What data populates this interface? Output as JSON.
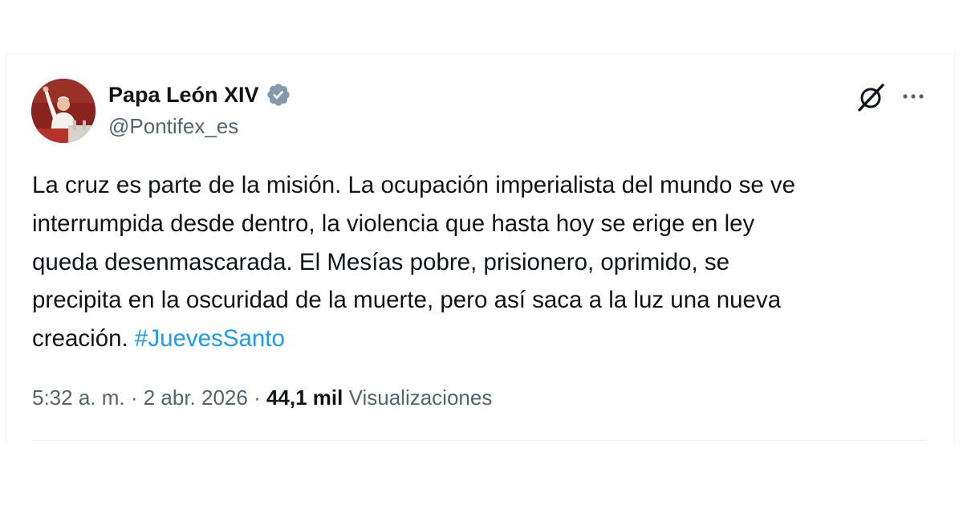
{
  "author": {
    "name": "Papa León XIV",
    "handle": "@Pontifex_es",
    "verified_color": "#829aab"
  },
  "tweet": {
    "text_lines": [
      "La cruz es parte de la misión. La ocupación imperialista del mundo se ve",
      "interrumpida desde dentro, la violencia que hasta hoy se erige en ley",
      "queda desenmascarada. El Mesías pobre, prisionero, oprimido, se",
      "precipita en la oscuridad de la muerte, pero así saca a la luz una nueva",
      "creación. "
    ],
    "hashtag": "#JuevesSanto",
    "hashtag_color": "#1d9bf0"
  },
  "meta": {
    "time": "5:32 a. m.",
    "separator": " · ",
    "date": "2 abr. 2026",
    "views_count": "44,1 mil",
    "views_label": " Visualizaciones"
  },
  "icons": {
    "grok": "grok-icon",
    "more": "more-icon",
    "verified": "verified-badge-icon"
  }
}
